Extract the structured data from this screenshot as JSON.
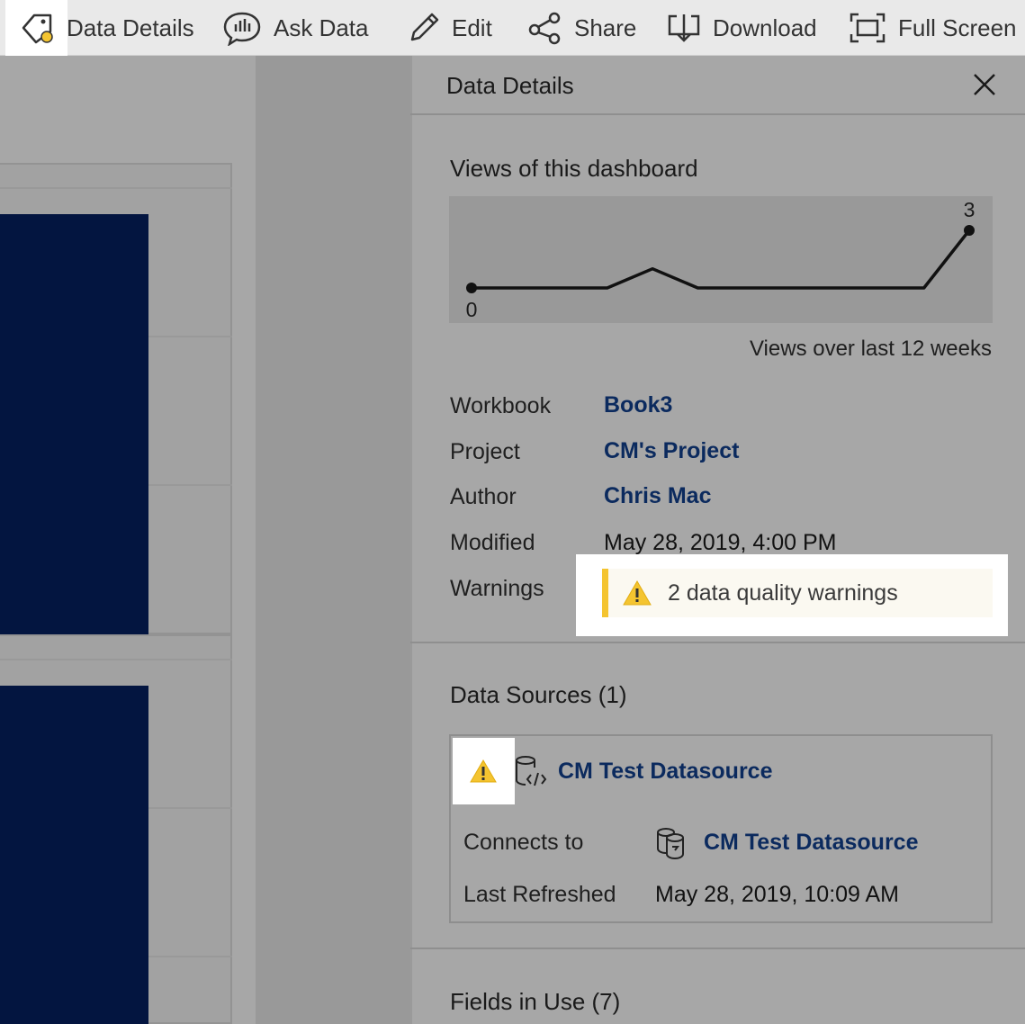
{
  "toolbar": {
    "data_details": "Data Details",
    "ask_data": "Ask Data",
    "edit": "Edit",
    "share": "Share",
    "download": "Download",
    "full_screen": "Full Screen"
  },
  "panel": {
    "title": "Data Details",
    "views": {
      "title": "Views of this dashboard",
      "caption": "Views over last 12 weeks",
      "min_label": "0",
      "max_label": "3",
      "chart_data": {
        "type": "line",
        "series": [
          {
            "values": [
              0,
              0,
              0,
              0,
              1,
              0,
              0,
              0,
              0,
              0,
              0,
              3
            ]
          }
        ],
        "ylim": [
          0,
          3
        ],
        "grid": false
      }
    },
    "details": {
      "workbook_label": "Workbook",
      "workbook_value": "Book3",
      "project_label": "Project",
      "project_value": "CM's Project",
      "author_label": "Author",
      "author_value": "Chris Mac",
      "modified_label": "Modified",
      "modified_value": "May 28, 2019, 4:00 PM",
      "warnings_label": "Warnings",
      "warnings_value": "2 data quality warnings"
    },
    "data_sources": {
      "title": "Data Sources (1)",
      "name": "CM Test Datasource",
      "connects_label": "Connects to",
      "connects_value": "CM Test Datasource",
      "refreshed_label": "Last Refreshed",
      "refreshed_value": "May 28, 2019, 10:09 AM"
    },
    "fields": {
      "title": "Fields in Use (7)"
    }
  },
  "colors": {
    "link": "#0b2a5e",
    "warning": "#f4c430",
    "bar": "#031540"
  }
}
